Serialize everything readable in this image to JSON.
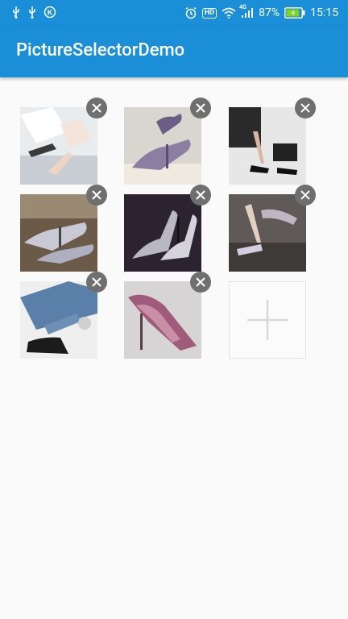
{
  "status_bar": {
    "left_icons": [
      "usb-icon",
      "usb-icon",
      "k-app-icon"
    ],
    "right_icons": [
      "alarm-icon",
      "hd-icon",
      "wifi-icon",
      "signal-icon",
      "battery-icon"
    ],
    "hd_label": "HD",
    "network_label": "4G",
    "battery_percent": "87%",
    "battery_level": 0.87,
    "time": "15:15"
  },
  "app_bar": {
    "title": "PictureSelectorDemo",
    "color": "#1a8fd8"
  },
  "grid": {
    "columns": 3,
    "thumbnails": [
      {
        "name": "photo-1",
        "delete_icon": "close-icon"
      },
      {
        "name": "photo-2",
        "delete_icon": "close-icon"
      },
      {
        "name": "photo-3",
        "delete_icon": "close-icon"
      },
      {
        "name": "photo-4",
        "delete_icon": "close-icon"
      },
      {
        "name": "photo-5",
        "delete_icon": "close-icon"
      },
      {
        "name": "photo-6",
        "delete_icon": "close-icon"
      },
      {
        "name": "photo-7",
        "delete_icon": "close-icon"
      },
      {
        "name": "photo-8",
        "delete_icon": "close-icon"
      }
    ],
    "add_button_icon": "plus-icon"
  }
}
